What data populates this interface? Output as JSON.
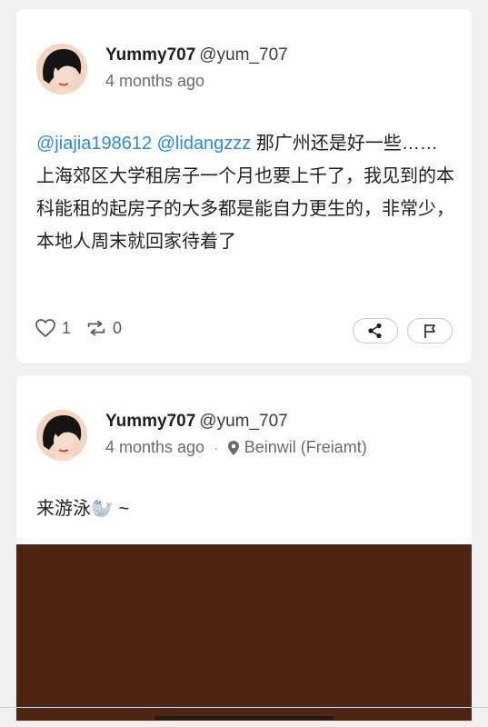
{
  "posts": [
    {
      "author": {
        "display_name": "Yummy707",
        "handle": "@yum_707"
      },
      "time": "4 months ago",
      "mentions": [
        "@jiajia198612",
        "@lidangzzz"
      ],
      "text": " 那广州还是好一些……上海郊区大学租房子一个月也要上千了，我见到的本科能租的起房子的大多都是能自力更生的，非常少，本地人周末就回家待着了",
      "likes": "1",
      "reposts": "0",
      "icons": [
        "heart-icon",
        "repost-icon",
        "share-icon",
        "flag-icon"
      ]
    },
    {
      "author": {
        "display_name": "Yummy707",
        "handle": "@yum_707"
      },
      "time": "4 months ago",
      "separator": "·",
      "location": "Beinwil (Freiamt)",
      "text": "来游泳🦭 ~",
      "photo_color": "#4e2513"
    }
  ]
}
